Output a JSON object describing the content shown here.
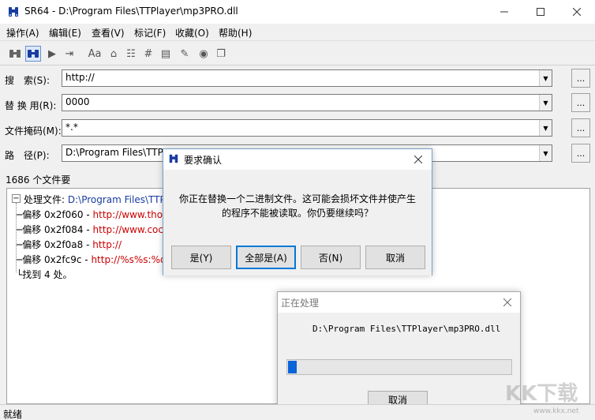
{
  "window": {
    "title": "SR64 - D:\\Program Files\\TTPlayer\\mp3PRO.dll"
  },
  "menu": [
    "操作(A)",
    "编辑(E)",
    "查看(V)",
    "标记(F)",
    "收藏(O)",
    "帮助(H)"
  ],
  "fields": {
    "search": {
      "label": "搜　索(S):",
      "value": "http://"
    },
    "replace": {
      "label": "替 换 用(R):",
      "value": "0000"
    },
    "mask": {
      "label": "文件掩码(M):",
      "value": "*.*"
    },
    "path": {
      "label": "路　径(P):",
      "value": "D:\\Program Files\\TTP"
    },
    "browse": "..."
  },
  "file_count": "1686 个文件要",
  "results": {
    "process_label": "处理文件:",
    "process_path": "D:\\Program Files\\TTP",
    "lines": [
      {
        "offset": "偏移 0x2f060",
        "sep": " - ",
        "url": "http://www.tho"
      },
      {
        "offset": "偏移 0x2f084",
        "sep": " - ",
        "url": "http://www.coc"
      },
      {
        "offset": "偏移 0x2f0a8",
        "sep": " - ",
        "url": "http://"
      },
      {
        "offset": "偏移 0x2fc9c",
        "sep": " - ",
        "url": "http://%s%s:%d"
      }
    ],
    "found": "找到 4 处。"
  },
  "confirm_dialog": {
    "title": "要求确认",
    "message_line1": "你正在替换一个二进制文件。这可能会损坏文件并使产生",
    "message_line2": "的程序不能被读取。你仍要继续吗？",
    "buttons": [
      "是(Y)",
      "全部是(A)",
      "否(N)",
      "取消"
    ]
  },
  "progress_dialog": {
    "title": "正在处理",
    "path": "D:\\Program Files\\TTPlayer\\mp3PRO.dll",
    "progress": 0.04,
    "cancel": "取消"
  },
  "status": "就绪",
  "watermark": {
    "text": "KK下载",
    "url": "www.kkx.net"
  }
}
